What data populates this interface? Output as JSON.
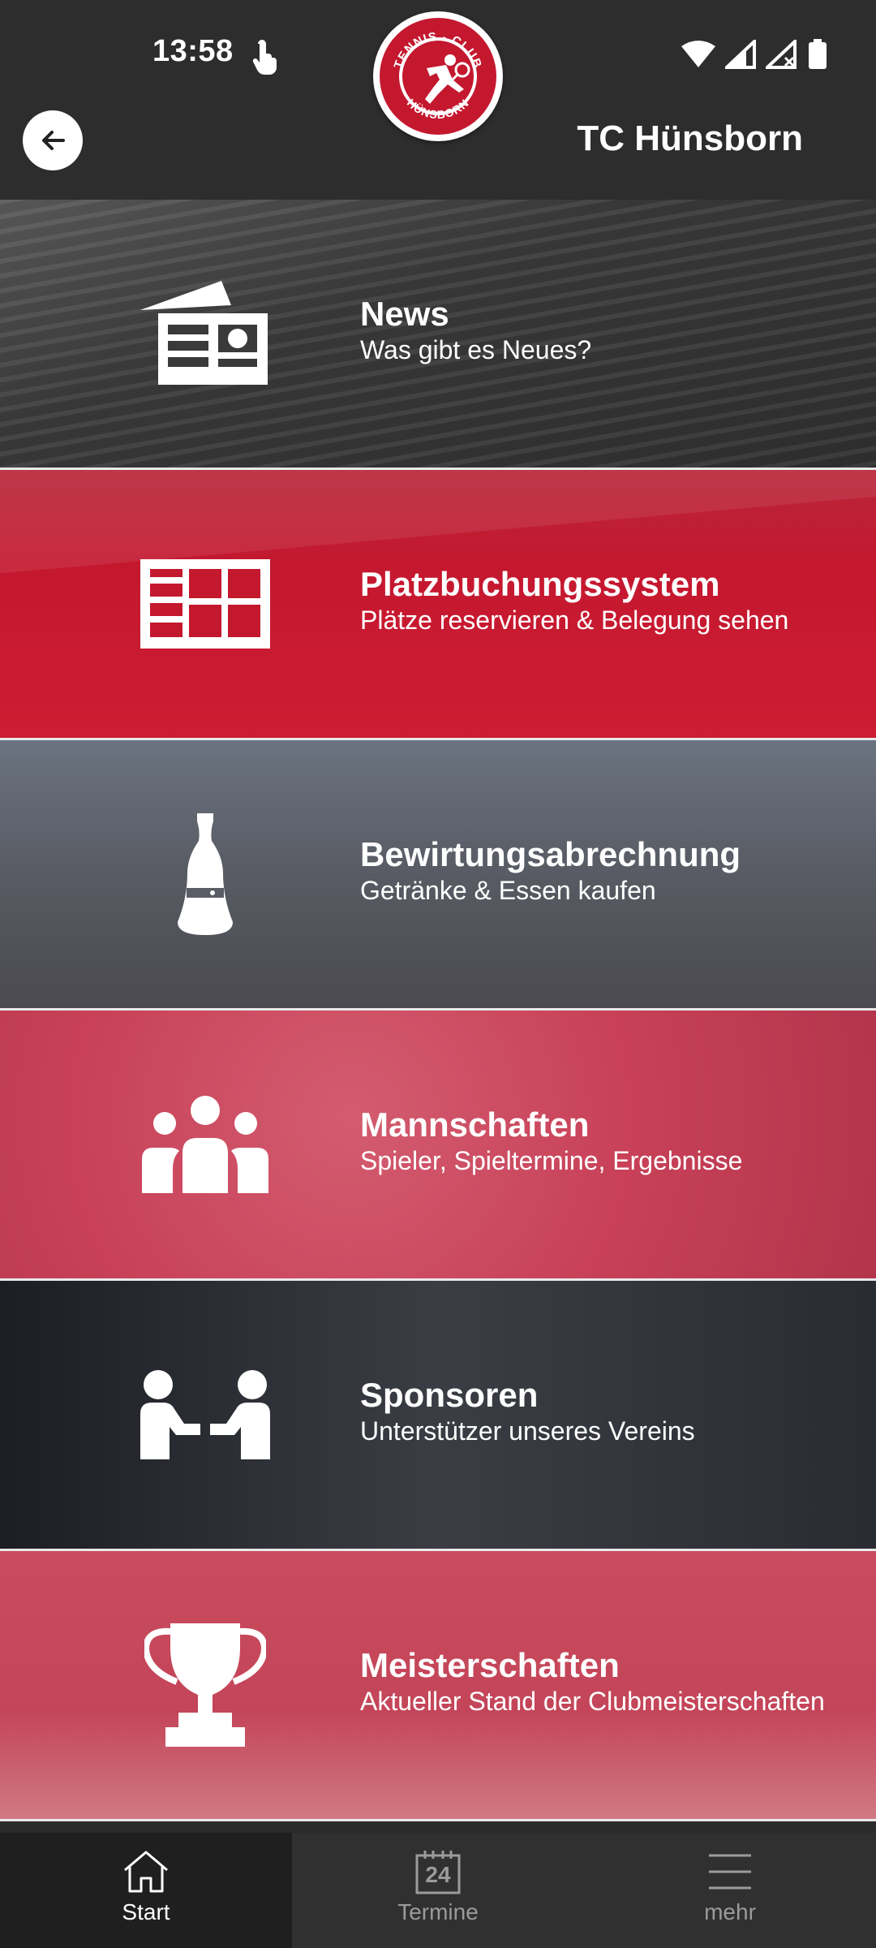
{
  "status_bar": {
    "time": "13:58",
    "icons": [
      "touch-icon",
      "wifi-icon",
      "signal-icon",
      "signal-x-icon",
      "battery-icon"
    ]
  },
  "app_bar": {
    "title": "TC Hünsborn",
    "back_icon": "arrow-left-icon",
    "logo_text_top": "TENNIS - CLUB",
    "logo_text_bottom": "HÜNSBORN"
  },
  "tiles": [
    {
      "title": "News",
      "subtitle": "Was gibt es Neues?",
      "icon": "newspaper-icon",
      "bg": "#3f3f3f"
    },
    {
      "title": "Platzbuchungssystem",
      "subtitle": "Plätze reservieren & Belegung sehen",
      "icon": "tennis-court-icon",
      "bg": "#c4182f"
    },
    {
      "title": "Bewirtungsabrechnung",
      "subtitle": "Getränke & Essen kaufen",
      "icon": "bottle-icon",
      "bg": "#5a5d66"
    },
    {
      "title": "Mannschaften",
      "subtitle": "Spieler, Spieltermine, Ergebnisse",
      "icon": "team-icon",
      "bg": "#c84158"
    },
    {
      "title": "Sponsoren",
      "subtitle": "Unterstützer unseres Vereins",
      "icon": "handshake-icon",
      "bg": "#2a2c33"
    },
    {
      "title": "Meisterschaften",
      "subtitle": "Aktueller Stand der Clubmeisterschaften",
      "icon": "trophy-icon",
      "bg": "#c84b5d"
    }
  ],
  "bottom_nav": [
    {
      "label": "Start",
      "icon": "home-icon",
      "active": true
    },
    {
      "label": "Termine",
      "icon": "calendar-icon",
      "calendar_day": "24",
      "active": false
    },
    {
      "label": "mehr",
      "icon": "menu-icon",
      "active": false
    }
  ],
  "colors": {
    "brand_red": "#c4182f",
    "bar_dark": "#2d2d2d"
  }
}
